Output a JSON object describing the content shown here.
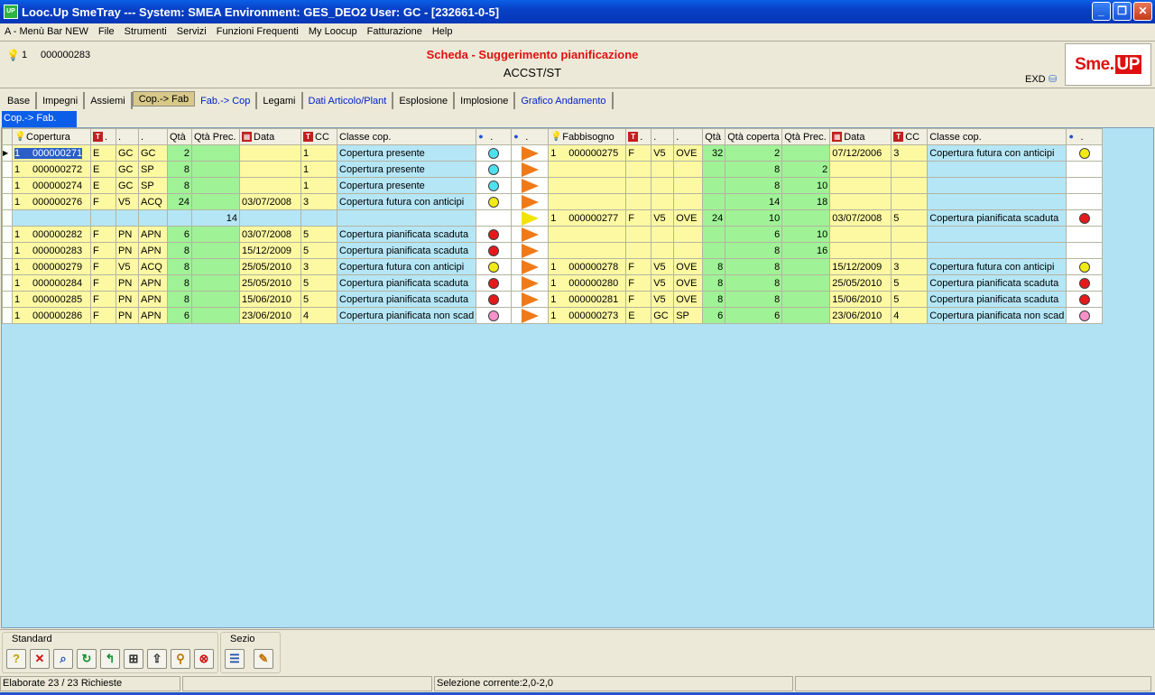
{
  "window": {
    "app_icon_text": "UP",
    "title": "Looc.Up SmeTray --- System: SMEA Environment: GES_DEO2 User: GC - [232661-0-5]",
    "buttons": {
      "minimize": "_",
      "restore": "❐",
      "close": "✕"
    }
  },
  "menu": [
    "A - Menù Bar NEW",
    "File",
    "Strumenti",
    "Servizi",
    "Funzioni Frequenti",
    "My Loocup",
    "Fatturazione",
    "Help"
  ],
  "header": {
    "count": "1",
    "code": "000000283",
    "title": "Scheda - Suggerimento pianificazione",
    "subtitle": "ACCST/ST",
    "exd": "EXD",
    "logo_left": "Sme.",
    "logo_right": "UP"
  },
  "tabs": [
    {
      "label": "Base",
      "blue": false,
      "active": false
    },
    {
      "label": "Impegni",
      "blue": false,
      "active": false
    },
    {
      "label": "Assiemi",
      "blue": false,
      "active": false
    },
    {
      "label": "Cop.-> Fab",
      "blue": false,
      "active": true
    },
    {
      "label": "Fab.-> Cop",
      "blue": true,
      "active": false
    },
    {
      "label": "Legami",
      "blue": false,
      "active": false
    },
    {
      "label": "Dati Articolo/Plant",
      "blue": true,
      "active": false
    },
    {
      "label": "Esplosione",
      "blue": false,
      "active": false
    },
    {
      "label": "Implosione",
      "blue": false,
      "active": false
    },
    {
      "label": "Grafico Andamento",
      "blue": true,
      "active": false
    }
  ],
  "subtab": "Cop.-> Fab.",
  "grid": {
    "columns": [
      "Copertura",
      "",
      ".",
      ".",
      "Qtà",
      "Qtà Prec.",
      "Data",
      "CC",
      "Classe cop.",
      ".",
      ".",
      "Fabbisogno",
      "",
      ".",
      ".",
      "Qtà",
      "Qtà coperta",
      "Qtà Prec.",
      "Data",
      "CC",
      "Classe cop.",
      "."
    ],
    "rows": [
      {
        "n": "1",
        "cop": "000000271",
        "t": "E",
        "a": "GC",
        "b": "GC",
        "qta": "2",
        "qprec": "",
        "data": "",
        "cc": "1",
        "classe": "Copertura presente",
        "dot": "cyan",
        "tri": "orange",
        "fn": "1",
        "fab": "000000275",
        "ft": "F",
        "fa": "V5",
        "fb": "OVE",
        "fqta": "32",
        "fcop": "2",
        "fprec": "",
        "fdata": "07/12/2006",
        "fcc": "3",
        "fclasse": "Copertura futura con anticipi",
        "fdot": "yellow"
      },
      {
        "n": "1",
        "cop": "000000272",
        "t": "E",
        "a": "GC",
        "b": "SP",
        "qta": "8",
        "qprec": "",
        "data": "",
        "cc": "1",
        "classe": "Copertura presente",
        "dot": "cyan",
        "tri": "orange",
        "fn": "",
        "fab": "",
        "ft": "",
        "fa": "",
        "fb": "",
        "fqta": "",
        "fcop": "8",
        "fprec": "2",
        "fdata": "",
        "fcc": "",
        "fclasse": "",
        "fdot": ""
      },
      {
        "n": "1",
        "cop": "000000274",
        "t": "E",
        "a": "GC",
        "b": "SP",
        "qta": "8",
        "qprec": "",
        "data": "",
        "cc": "1",
        "classe": "Copertura presente",
        "dot": "cyan",
        "tri": "orange",
        "fn": "",
        "fab": "",
        "ft": "",
        "fa": "",
        "fb": "",
        "fqta": "",
        "fcop": "8",
        "fprec": "10",
        "fdata": "",
        "fcc": "",
        "fclasse": "",
        "fdot": ""
      },
      {
        "n": "1",
        "cop": "000000276",
        "t": "F",
        "a": "V5",
        "b": "ACQ",
        "qta": "24",
        "qprec": "",
        "data": "03/07/2008",
        "cc": "3",
        "classe": "Copertura futura con anticipi",
        "dot": "yellow",
        "tri": "orange",
        "fn": "",
        "fab": "",
        "ft": "",
        "fa": "",
        "fb": "",
        "fqta": "",
        "fcop": "14",
        "fprec": "18",
        "fdata": "",
        "fcc": "",
        "fclasse": "",
        "fdot": ""
      },
      {
        "n": "",
        "cop": "",
        "t": "",
        "a": "",
        "b": "",
        "qta": "",
        "qprec": "14",
        "data": "",
        "cc": "",
        "classe": "",
        "dot": "",
        "tri": "yellow",
        "fn": "1",
        "fab": "000000277",
        "ft": "F",
        "fa": "V5",
        "fb": "OVE",
        "fqta": "24",
        "fcop": "10",
        "fprec": "",
        "fdata": "03/07/2008",
        "fcc": "5",
        "fclasse": "Copertura pianificata scaduta",
        "fdot": "red"
      },
      {
        "n": "1",
        "cop": "000000282",
        "t": "F",
        "a": "PN",
        "b": "APN",
        "qta": "6",
        "qprec": "",
        "data": "03/07/2008",
        "cc": "5",
        "classe": "Copertura pianificata scaduta",
        "dot": "red",
        "tri": "orange",
        "fn": "",
        "fab": "",
        "ft": "",
        "fa": "",
        "fb": "",
        "fqta": "",
        "fcop": "6",
        "fprec": "10",
        "fdata": "",
        "fcc": "",
        "fclasse": "",
        "fdot": ""
      },
      {
        "n": "1",
        "cop": "000000283",
        "t": "F",
        "a": "PN",
        "b": "APN",
        "qta": "8",
        "qprec": "",
        "data": "15/12/2009",
        "cc": "5",
        "classe": "Copertura pianificata scaduta",
        "dot": "red",
        "tri": "orange",
        "fn": "",
        "fab": "",
        "ft": "",
        "fa": "",
        "fb": "",
        "fqta": "",
        "fcop": "8",
        "fprec": "16",
        "fdata": "",
        "fcc": "",
        "fclasse": "",
        "fdot": ""
      },
      {
        "n": "1",
        "cop": "000000279",
        "t": "F",
        "a": "V5",
        "b": "ACQ",
        "qta": "8",
        "qprec": "",
        "data": "25/05/2010",
        "cc": "3",
        "classe": "Copertura futura con anticipi",
        "dot": "yellow",
        "tri": "orange",
        "fn": "1",
        "fab": "000000278",
        "ft": "F",
        "fa": "V5",
        "fb": "OVE",
        "fqta": "8",
        "fcop": "8",
        "fprec": "",
        "fdata": "15/12/2009",
        "fcc": "3",
        "fclasse": "Copertura futura con anticipi",
        "fdot": "yellow"
      },
      {
        "n": "1",
        "cop": "000000284",
        "t": "F",
        "a": "PN",
        "b": "APN",
        "qta": "8",
        "qprec": "",
        "data": "25/05/2010",
        "cc": "5",
        "classe": "Copertura pianificata scaduta",
        "dot": "red",
        "tri": "orange",
        "fn": "1",
        "fab": "000000280",
        "ft": "F",
        "fa": "V5",
        "fb": "OVE",
        "fqta": "8",
        "fcop": "8",
        "fprec": "",
        "fdata": "25/05/2010",
        "fcc": "5",
        "fclasse": "Copertura pianificata scaduta",
        "fdot": "red"
      },
      {
        "n": "1",
        "cop": "000000285",
        "t": "F",
        "a": "PN",
        "b": "APN",
        "qta": "8",
        "qprec": "",
        "data": "15/06/2010",
        "cc": "5",
        "classe": "Copertura pianificata scaduta",
        "dot": "red",
        "tri": "orange",
        "fn": "1",
        "fab": "000000281",
        "ft": "F",
        "fa": "V5",
        "fb": "OVE",
        "fqta": "8",
        "fcop": "8",
        "fprec": "",
        "fdata": "15/06/2010",
        "fcc": "5",
        "fclasse": "Copertura pianificata scaduta",
        "fdot": "red"
      },
      {
        "n": "1",
        "cop": "000000286",
        "t": "F",
        "a": "PN",
        "b": "APN",
        "qta": "6",
        "qprec": "",
        "data": "23/06/2010",
        "cc": "4",
        "classe": "Copertura pianificata non scad",
        "dot": "pink",
        "tri": "orange",
        "fn": "1",
        "fab": "000000273",
        "ft": "E",
        "fa": "GC",
        "fb": "SP",
        "fqta": "6",
        "fcop": "6",
        "fprec": "",
        "fdata": "23/06/2010",
        "fcc": "4",
        "fclasse": "Copertura pianificata non scad",
        "fdot": "pink"
      }
    ]
  },
  "dot_colors": {
    "cyan": "#4fe0f0",
    "yellow": "#f2ea16",
    "red": "#e41a1a",
    "pink": "#f590c8"
  },
  "toolbar": {
    "standard_label": "Standard",
    "sezio_label": "Sezio",
    "standard_icons": [
      "help-icon",
      "close-icon",
      "search-icon",
      "refresh-icon",
      "back-icon",
      "cart-icon",
      "export-icon",
      "zoom-icon",
      "stop-icon"
    ],
    "sezio_icons": [
      "list-icon",
      "edit-icon"
    ]
  },
  "status": {
    "left": "Elaborate 23 / 23 Richieste",
    "mid": "",
    "selection": "Selezione corrente:2,0-2,0",
    "right": ""
  }
}
